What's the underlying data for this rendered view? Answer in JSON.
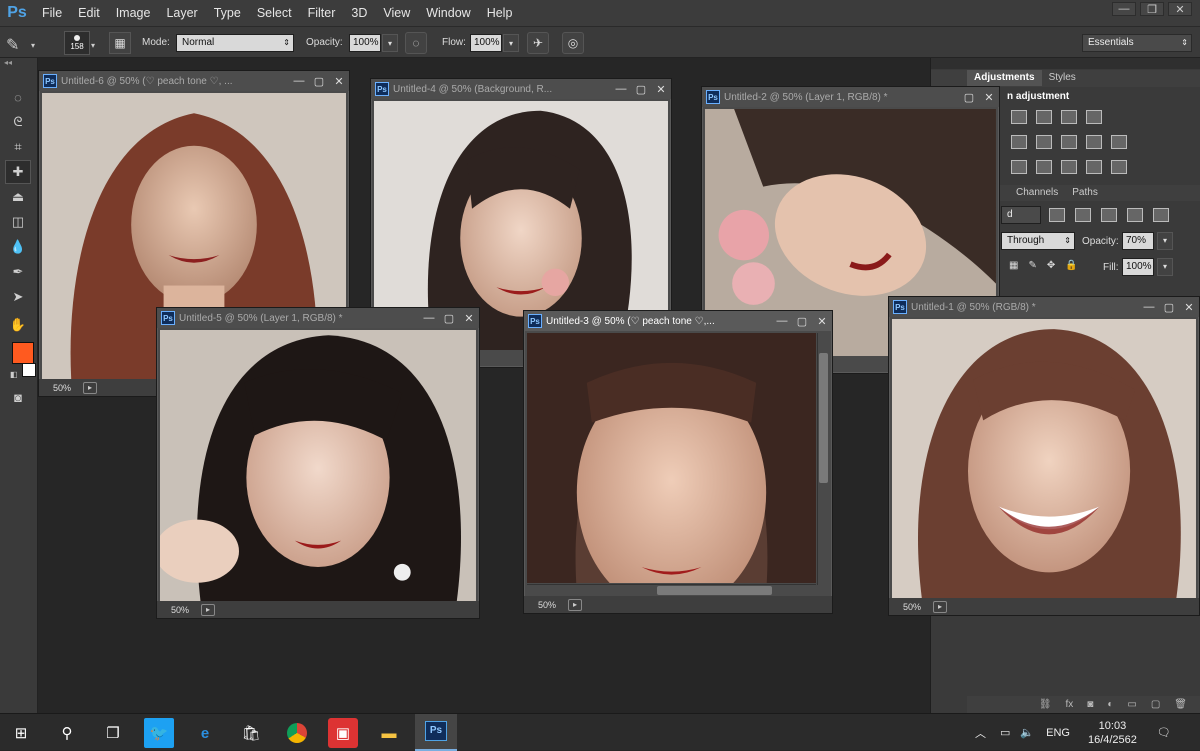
{
  "app": {
    "logo": "Ps",
    "menu": [
      "File",
      "Edit",
      "Image",
      "Layer",
      "Type",
      "Select",
      "Filter",
      "3D",
      "View",
      "Window",
      "Help"
    ],
    "window_buttons": [
      "—",
      "❐",
      "✕"
    ]
  },
  "options": {
    "brush_size": "158",
    "mode_label": "Mode:",
    "mode_value": "Normal",
    "opacity_label": "Opacity:",
    "opacity_value": "100%",
    "flow_label": "Flow:",
    "flow_value": "100%",
    "workspace_value": "Essentials"
  },
  "panels": {
    "tabs_top": [
      "Adjustments",
      "Styles"
    ],
    "adjustment_heading": "n adjustment",
    "tabs_mid": [
      "Channels",
      "Paths"
    ],
    "blend_partial": "d",
    "fill_partial": "Through",
    "opacity_label": "Opacity:",
    "opacity_value": "70%",
    "fill_label": "Fill:",
    "fill_value": "100%"
  },
  "docs": [
    {
      "title": "Untitled-6 @ 50% (♡ peach tone ♡, ...",
      "zoom": "50%"
    },
    {
      "title": "Untitled-4 @ 50% (Background, R...",
      "zoom": ""
    },
    {
      "title": "Untitled-2 @ 50% (Layer 1, RGB/8) *",
      "zoom": ""
    },
    {
      "title": "Untitled-5 @ 50% (Layer 1, RGB/8) *",
      "zoom": "50%"
    },
    {
      "title": "Untitled-3 @ 50% (♡ peach tone ♡,...",
      "zoom": "50%"
    },
    {
      "title": "Untitled-1 @ 50% (RGB/8) *",
      "zoom": "50%"
    }
  ],
  "colors": {
    "foreground": "#ff5a1f",
    "background": "#ffffff",
    "ps_blue": "#4fa3e6"
  },
  "taskbar": {
    "lang": "ENG",
    "time": "10:03",
    "date": "16/4/2562"
  }
}
